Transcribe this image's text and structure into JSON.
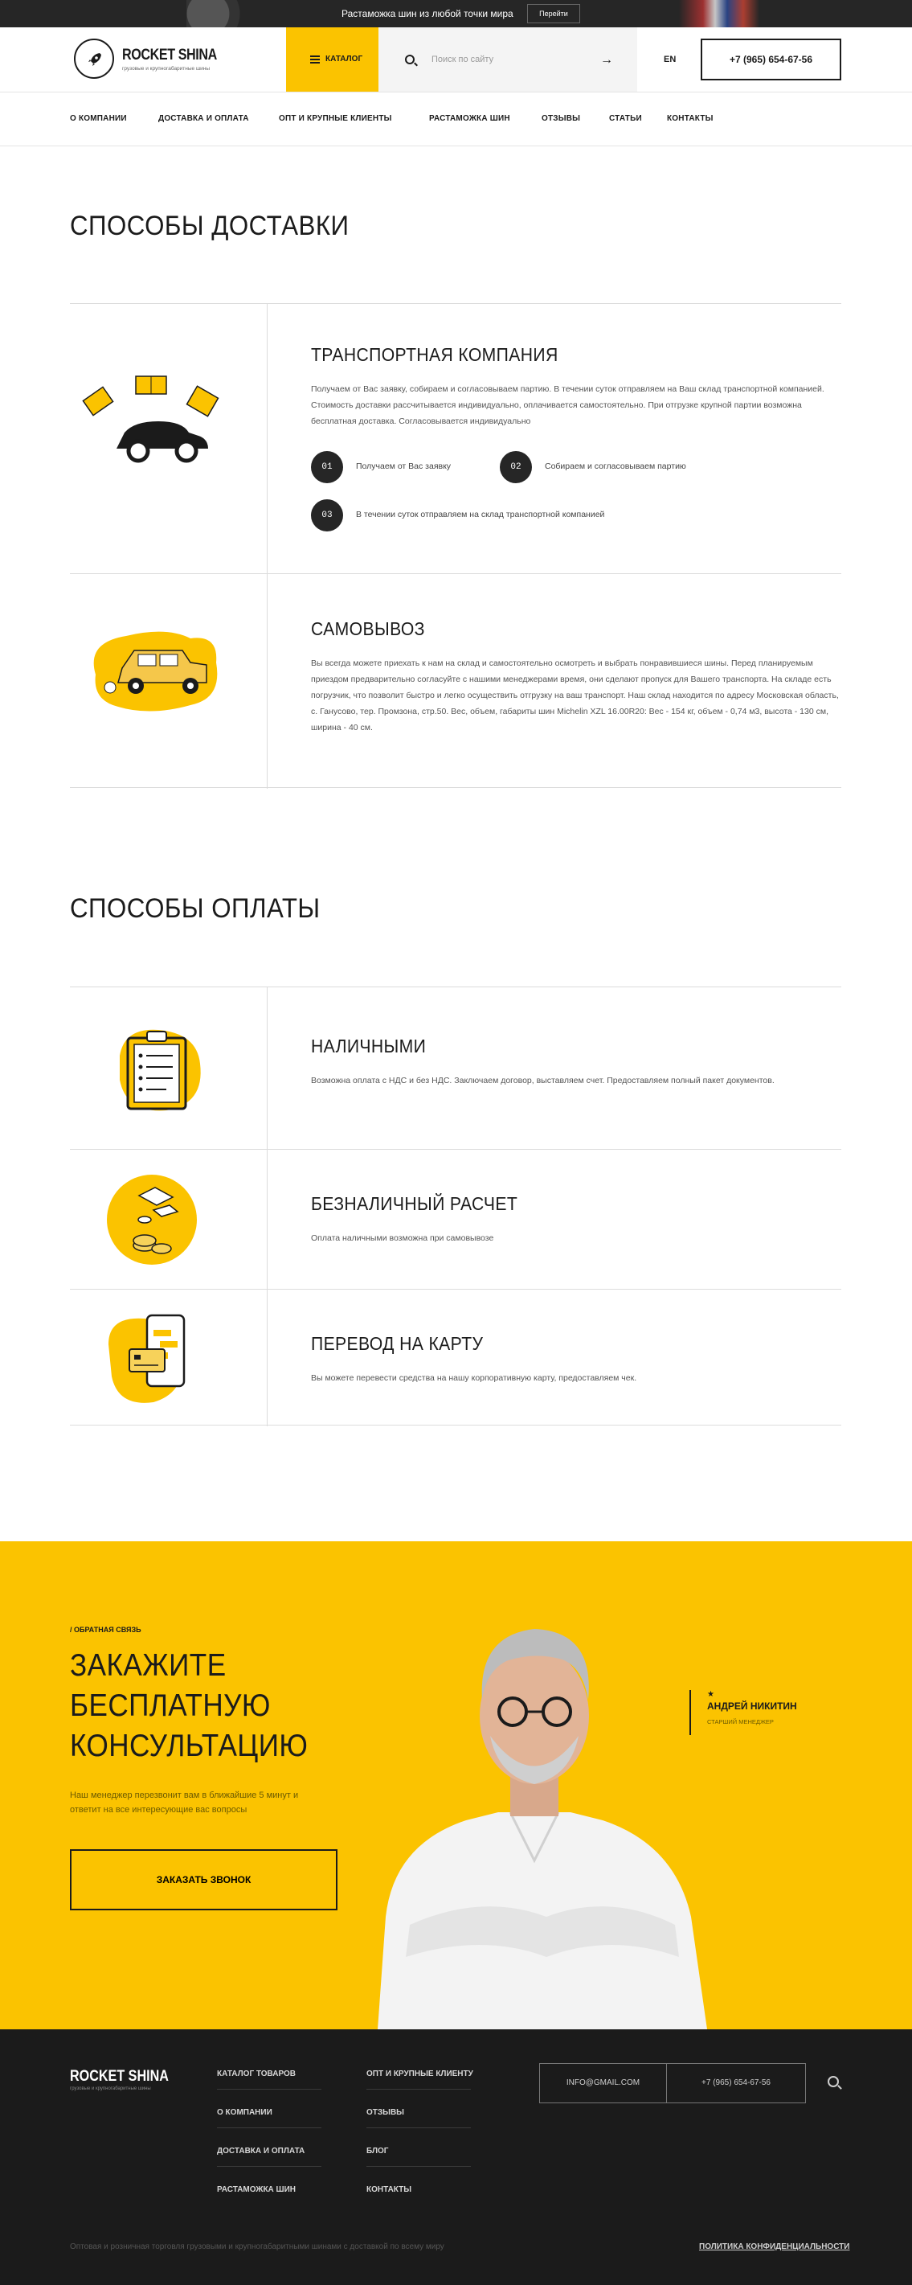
{
  "topbar": {
    "promo_text": "Растаможка шин из любой точки мира",
    "promo_button": "Перейти"
  },
  "header": {
    "logo_title": "ROCKET SHINA",
    "logo_subtitle": "грузовые и крупногабаритные шины",
    "catalog_button": "КАТАЛОГ ТОВАРОВ",
    "search_placeholder": "Поиск по сайту",
    "language": "EN",
    "phone": "+7 (965) 654-67-56"
  },
  "nav": {
    "items": [
      "О КОМПАНИИ",
      "ДОСТАВКА И ОПЛАТА",
      "ОПТ И КРУПНЫЕ КЛИЕНТЫ",
      "РАСТАМОЖКА ШИН",
      "ОТЗЫВЫ",
      "СТАТЬИ",
      "КОНТАКТЫ"
    ]
  },
  "delivery": {
    "title": "СПОСОБЫ ДОСТАВКИ",
    "transport": {
      "heading": "ТРАНСПОРТНАЯ КОМПАНИЯ",
      "text": "Получаем от Вас заявку, собираем и согласовываем партию. В течении суток отправляем на Ваш склад транспортной компанией. Стоимость доставки рассчитывается индивидуально, оплачивается самостоятельно. При отгрузке крупной партии возможна бесплатная доставка. Согласовывается индивидуально",
      "steps": [
        {
          "num": "01",
          "text": "Получаем от Вас заявку"
        },
        {
          "num": "02",
          "text": "Собираем и согласовываем партию"
        },
        {
          "num": "03",
          "text": "В течении суток отправляем на склад транспортной компанией"
        }
      ]
    },
    "pickup": {
      "heading": "САМОВЫВОЗ",
      "text": "Вы всегда можете приехать к нам на склад и самостоятельно осмотреть и выбрать понравившиеся шины. Перед планируемым приездом предварительно согласуйте с нашими менеджерами время, они сделают пропуск для Вашего транспорта. На складе есть погрузчик, что позволит быстро и легко осуществить отгрузку на ваш транспорт. Наш склад находится по адресу Московская область, с. Ганусово, тер. Промзона, стр.50. Вес, объем, габариты шин Michelin XZL 16.00R20: Вес - 154 кг, объем - 0,74 м3, высота - 130 см, ширина - 40 см."
    }
  },
  "payment": {
    "title": "СПОСОБЫ ОПЛАТЫ",
    "cash": {
      "heading": "НАЛИЧНЫМИ",
      "text": "Возможна оплата с НДС и без НДС. Заключаем договор, выставляем счет. Предоставляем полный пакет документов."
    },
    "cashless": {
      "heading": "БЕЗНАЛИЧНЫЙ РАСЧЕТ",
      "text": "Оплата наличными возможна при самовывозе"
    },
    "card": {
      "heading": "ПЕРЕВОД НА КАРТУ",
      "text": "Вы можете перевести средства на нашу корпоративную карту, предоставляем чек."
    }
  },
  "cta": {
    "eyebrow": "/ ОБРАТНАЯ СВЯЗЬ",
    "title_lines": [
      "ЗАКАЖИТЕ",
      "БЕСПЛАТНУЮ",
      "КОНСУЛЬТАЦИЮ"
    ],
    "lead": "Наш менеджер перезвонит вам в ближайшие 5 минут и ответит на все интересующие вас вопросы",
    "button": "ЗАКАЗАТЬ ЗВОНОК",
    "manager_name": "АНДРЕЙ НИКИТИН",
    "manager_role": "СТАРШИЙ МЕНЕДЖЕР",
    "manager_star": "★"
  },
  "footer": {
    "logo_title": "ROCKET SHINA",
    "logo_subtitle": "грузовые и крупногабаритные шины",
    "col1": [
      "КАТАЛОГ ТОВАРОВ",
      "О КОМПАНИИ",
      "ДОСТАВКА И ОПЛАТА",
      "РАСТАМОЖКА ШИН"
    ],
    "col2": [
      "ОПТ И КРУПНЫЕ КЛИЕНТУ",
      "ОТЗЫВЫ",
      "БЛОГ",
      "КОНТАКТЫ"
    ],
    "email": "INFO@GMAIL.COM",
    "phone": "+7 (965) 654-67-56",
    "copyright": "Оптовая и розничная торговля грузовыми и крупногабаритными шинами с доставкой по всему миру",
    "policy": "ПОЛИТИКА КОНФИДЕНЦИАЛЬНОСТИ"
  },
  "colors": {
    "accent": "#fbc300",
    "dark": "#1b1b1b",
    "topbar": "#262626"
  },
  "icons": [
    "rocket-icon",
    "burger-icon",
    "search-icon",
    "arrow-right-icon",
    "boxes-car-icon",
    "jeep-icon",
    "clipboard-icon",
    "coins-icon",
    "phone-card-icon",
    "star-icon"
  ]
}
